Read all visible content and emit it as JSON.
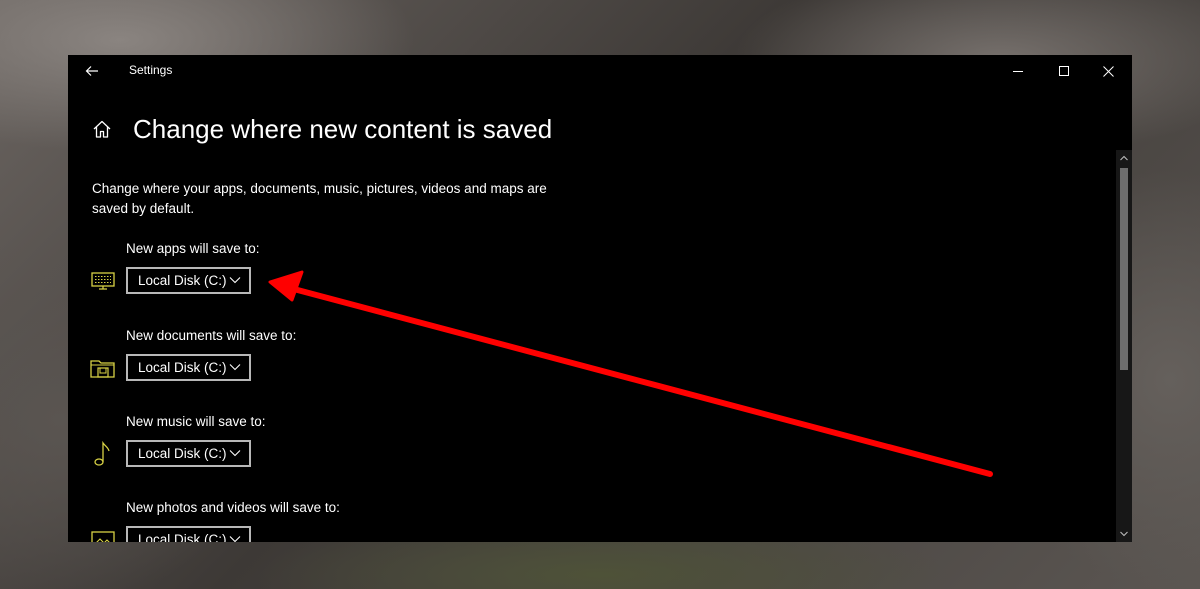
{
  "window": {
    "title": "Settings",
    "controls": {
      "minimize": "minimize-icon",
      "maximize": "maximize-icon",
      "close": "close-icon"
    }
  },
  "page": {
    "title": "Change where new content is saved",
    "description": "Change where your apps, documents, music, pictures, videos and maps are saved by default."
  },
  "settings": [
    {
      "label": "New apps will save to:",
      "value": "Local Disk (C:)",
      "icon": "apps-monitor-icon"
    },
    {
      "label": "New documents will save to:",
      "value": "Local Disk (C:)",
      "icon": "documents-folder-icon"
    },
    {
      "label": "New music will save to:",
      "value": "Local Disk (C:)",
      "icon": "music-note-icon"
    },
    {
      "label": "New photos and videos will save to:",
      "value": "Local Disk (C:)",
      "icon": "photos-icon"
    }
  ],
  "colors": {
    "window_bg": "#000000",
    "icon_accent": "#d8d245",
    "annotation_arrow": "#ff0000",
    "dropdown_border": "#b8b8b8"
  }
}
